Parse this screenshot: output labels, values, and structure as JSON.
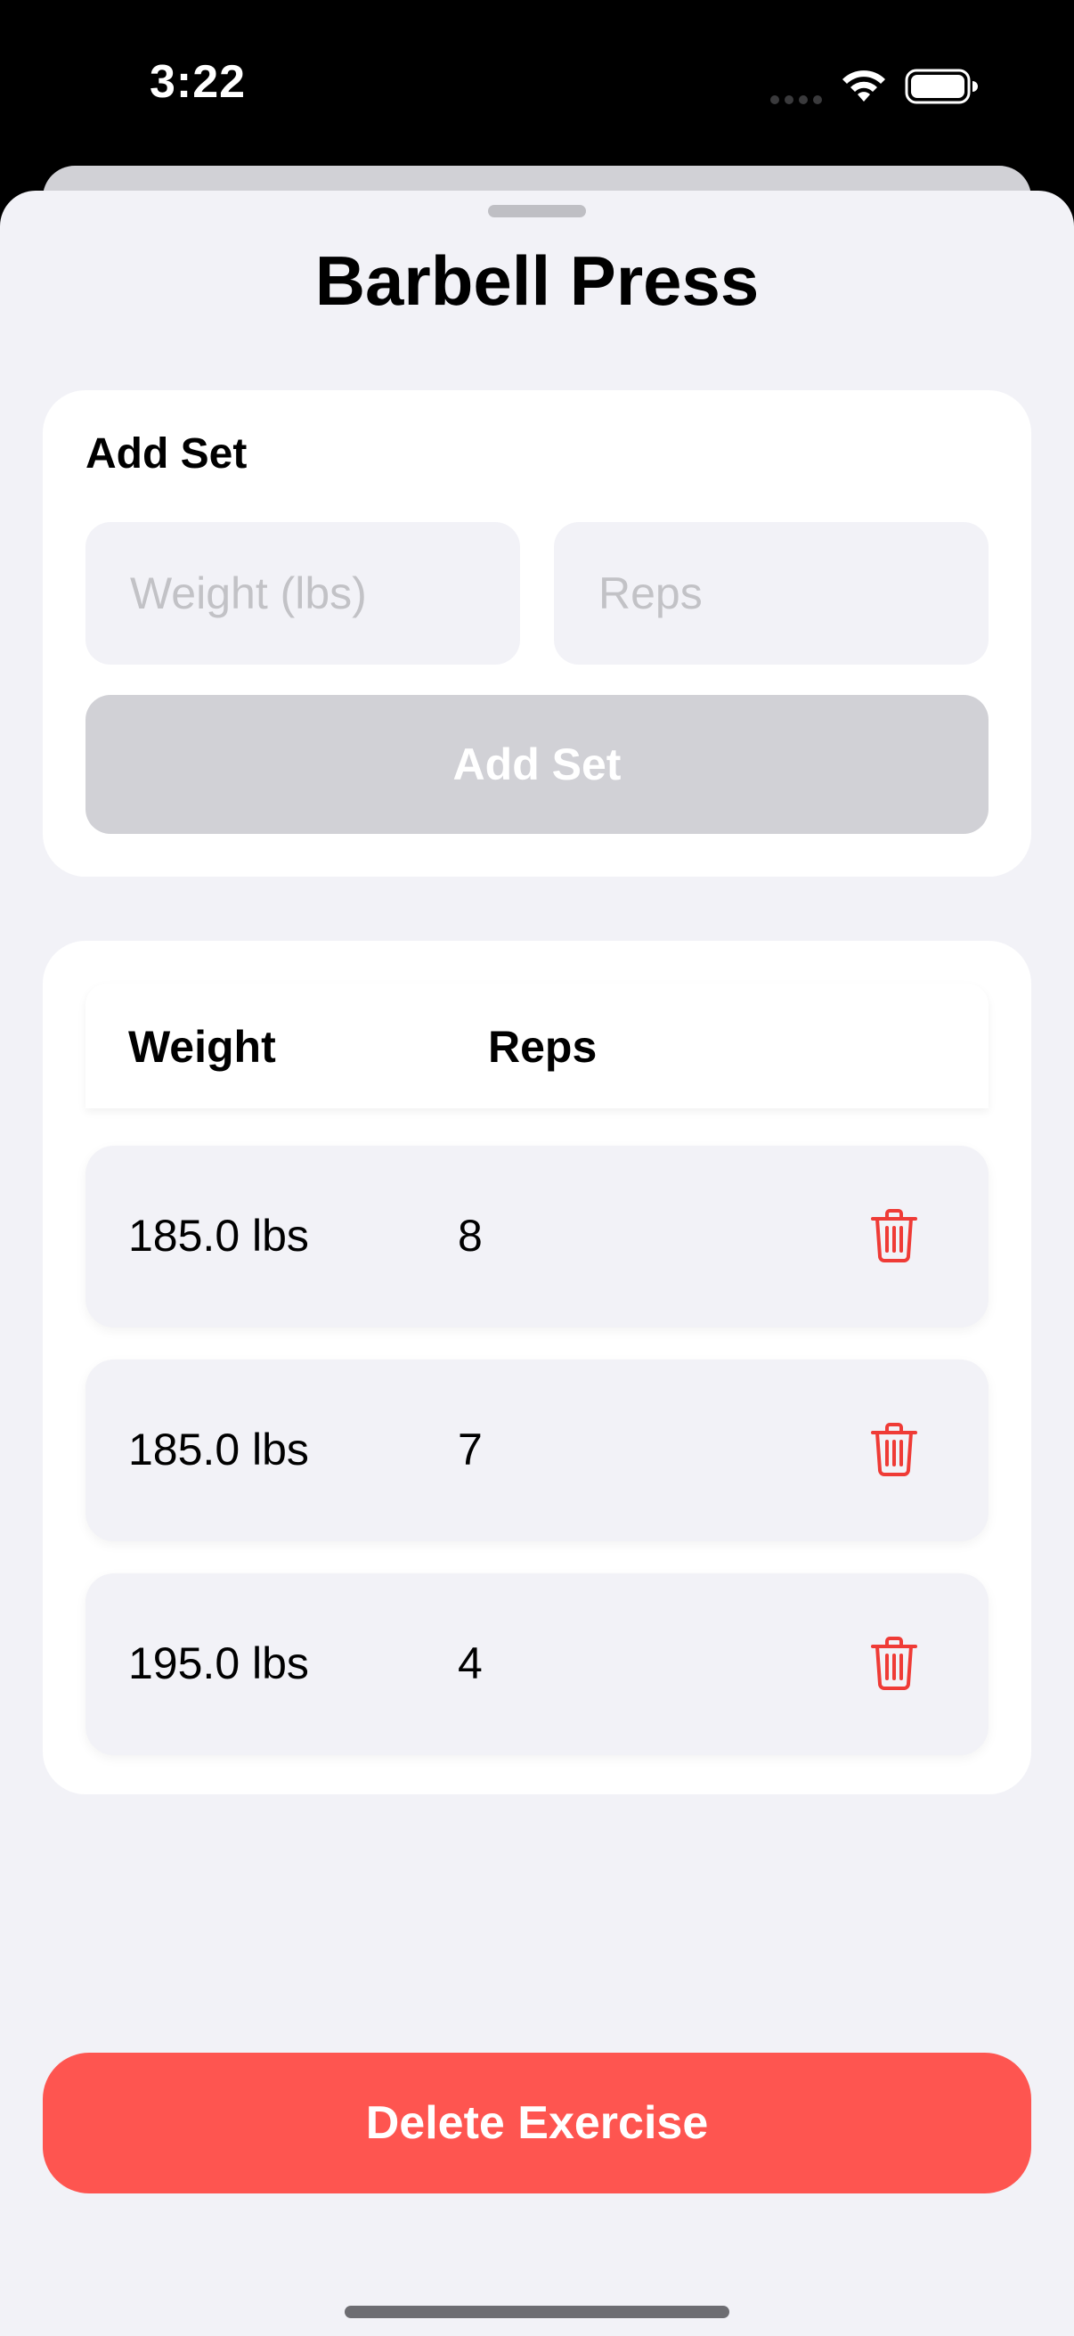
{
  "status_bar": {
    "time": "3:22",
    "signal_icon": "cellular-dots-icon",
    "wifi_icon": "wifi-icon",
    "battery_icon": "battery-full-icon"
  },
  "sheet": {
    "title": "Barbell Press"
  },
  "add_set": {
    "heading": "Add Set",
    "weight_placeholder": "Weight (lbs)",
    "weight_value": "",
    "reps_placeholder": "Reps",
    "reps_value": "",
    "button_label": "Add Set"
  },
  "sets_table": {
    "columns": [
      "Weight",
      "Reps"
    ],
    "rows": [
      {
        "weight": "185.0 lbs",
        "reps": "8",
        "action_icon": "trash-icon"
      },
      {
        "weight": "185.0 lbs",
        "reps": "7",
        "action_icon": "trash-icon"
      },
      {
        "weight": "195.0 lbs",
        "reps": "4",
        "action_icon": "trash-icon"
      }
    ]
  },
  "delete_button": {
    "label": "Delete Exercise"
  },
  "colors": {
    "background": "#f2f2f7",
    "card": "#ffffff",
    "destructive": "#fe5550",
    "trash_icon": "#ef3b36",
    "disabled_button": "#d1d1d6"
  }
}
